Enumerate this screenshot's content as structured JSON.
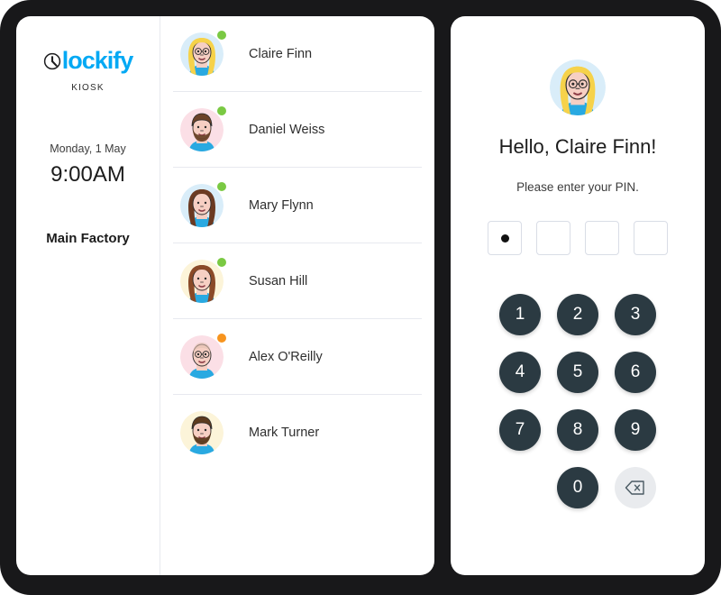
{
  "app": {
    "brand_name": "lockify",
    "brand_initial": "C",
    "brand_subtitle": "KIOSK",
    "brand_color": "#03a9f4",
    "frame_color": "#18181a"
  },
  "sidebar": {
    "date": "Monday, 1 May",
    "time": "9:00AM",
    "workspace": "Main Factory"
  },
  "user_list": {
    "users": [
      {
        "name": "Claire Finn",
        "status": "online",
        "status_color": "#7ac943",
        "avatar_bg": "#d9edf9",
        "hair": "#f6d24a",
        "skin": "#f6cfc3",
        "shirt": "#29a9e1"
      },
      {
        "name": "Daniel Weiss",
        "status": "online",
        "status_color": "#7ac943",
        "avatar_bg": "#fbdfe6",
        "hair": "#6b4329",
        "skin": "#f6cfc3",
        "shirt": "#29a9e1"
      },
      {
        "name": "Mary Flynn",
        "status": "online",
        "status_color": "#7ac943",
        "avatar_bg": "#d9edf9",
        "hair": "#6b3a22",
        "skin": "#f6cfc3",
        "shirt": "#29a9e1"
      },
      {
        "name": "Susan Hill",
        "status": "online",
        "status_color": "#7ac943",
        "avatar_bg": "#fcf4d9",
        "hair": "#8a4a28",
        "skin": "#f6cfc3",
        "shirt": "#29a9e1"
      },
      {
        "name": "Alex O'Reilly",
        "status": "away",
        "status_color": "#f7941e",
        "avatar_bg": "#fbdfe6",
        "hair": "#e3bfb0",
        "skin": "#f6cfc3",
        "shirt": "#29a9e1"
      },
      {
        "name": "Mark Turner",
        "status": "offline",
        "status_color": "",
        "avatar_bg": "#fcf4d9",
        "hair": "#5c3a1e",
        "skin": "#f6cfc3",
        "shirt": "#29a9e1"
      }
    ]
  },
  "pin_panel": {
    "greeting": "Hello, Claire Finn!",
    "prompt": "Please enter your PIN.",
    "pin_length": 4,
    "pin_entered": 1,
    "keys": [
      "1",
      "2",
      "3",
      "4",
      "5",
      "6",
      "7",
      "8",
      "9",
      "",
      "0",
      "backspace"
    ],
    "backspace_label": "backspace-key",
    "key_color": "#2b3a42",
    "backspace_color": "#e9ebee"
  }
}
